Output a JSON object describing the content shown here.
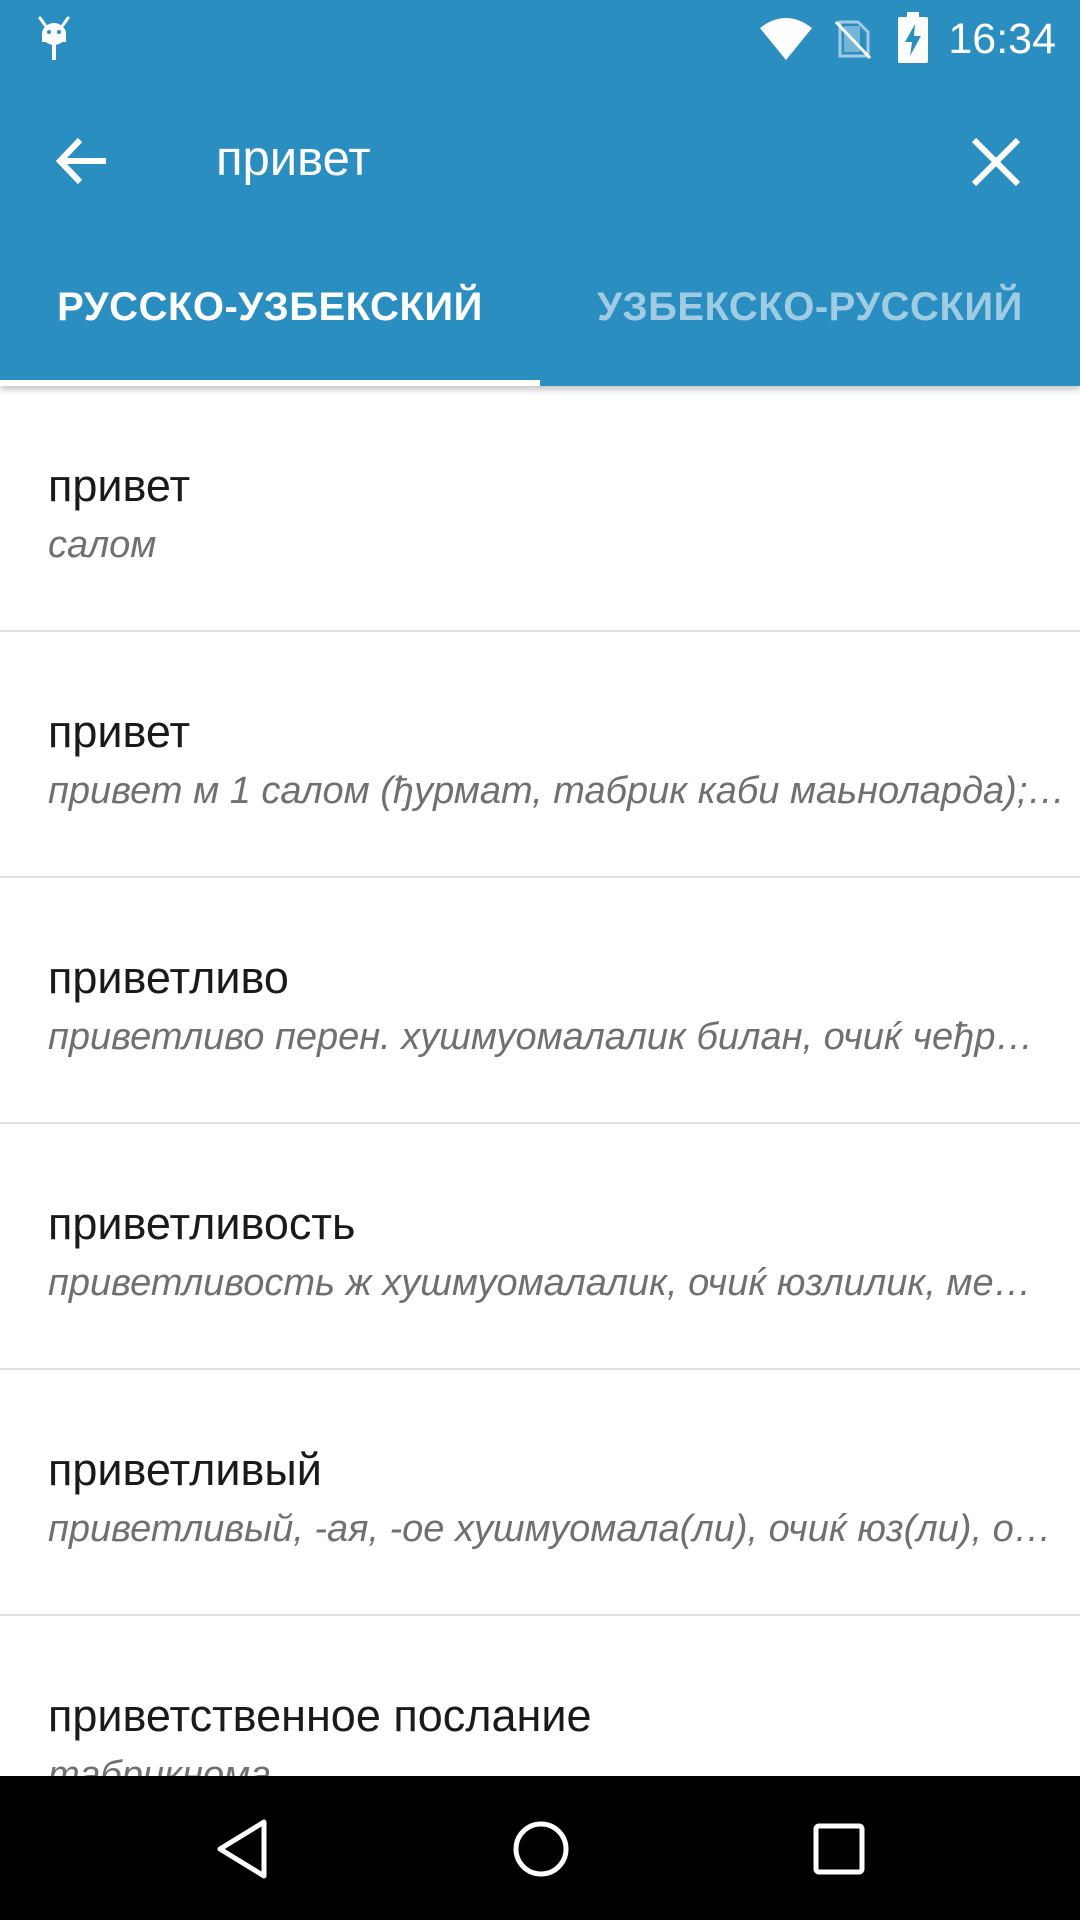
{
  "status_bar": {
    "time": "16:34",
    "icons": [
      "android-debug-icon",
      "wifi-icon",
      "no-sim-icon",
      "battery-charging-icon"
    ]
  },
  "toolbar": {
    "back_icon": "arrow-back-icon",
    "search_value": "привет",
    "clear_icon": "close-icon"
  },
  "tabs": [
    {
      "label": "РУССКО-УЗБЕКСКИЙ",
      "active": true
    },
    {
      "label": "УЗБЕКСКО-РУССКИЙ",
      "active": false
    }
  ],
  "results": [
    {
      "word": "привет",
      "translation": "салом"
    },
    {
      "word": "привет",
      "translation": "привет м 1 салом (ђурмат, табрик каби маьноларда);…"
    },
    {
      "word": "приветливо",
      "translation": "приветливо перен. хушмуомалалик билан, очиќ чеђр…"
    },
    {
      "word": "приветливость",
      "translation": "приветливость ж хушмуомалалик, очиќ юзлилик, ме…"
    },
    {
      "word": "приветливый",
      "translation": "приветливый, -ая, -ое хушмуомала(ли), очиќ юз(ли), о…"
    },
    {
      "word": "приветственное послание",
      "translation": "табрикнома"
    }
  ],
  "nav_bar": {
    "icons": [
      "nav-back-icon",
      "nav-home-icon",
      "nav-recents-icon"
    ]
  },
  "colors": {
    "primary": "#2b8ec1",
    "tab_active_text": "#ffffff",
    "tab_inactive_text": "#9fcbe3",
    "word_text": "#1a1a1a",
    "translation_text": "#707070",
    "divider": "#e0e0e0",
    "nav_bar": "#000000"
  }
}
